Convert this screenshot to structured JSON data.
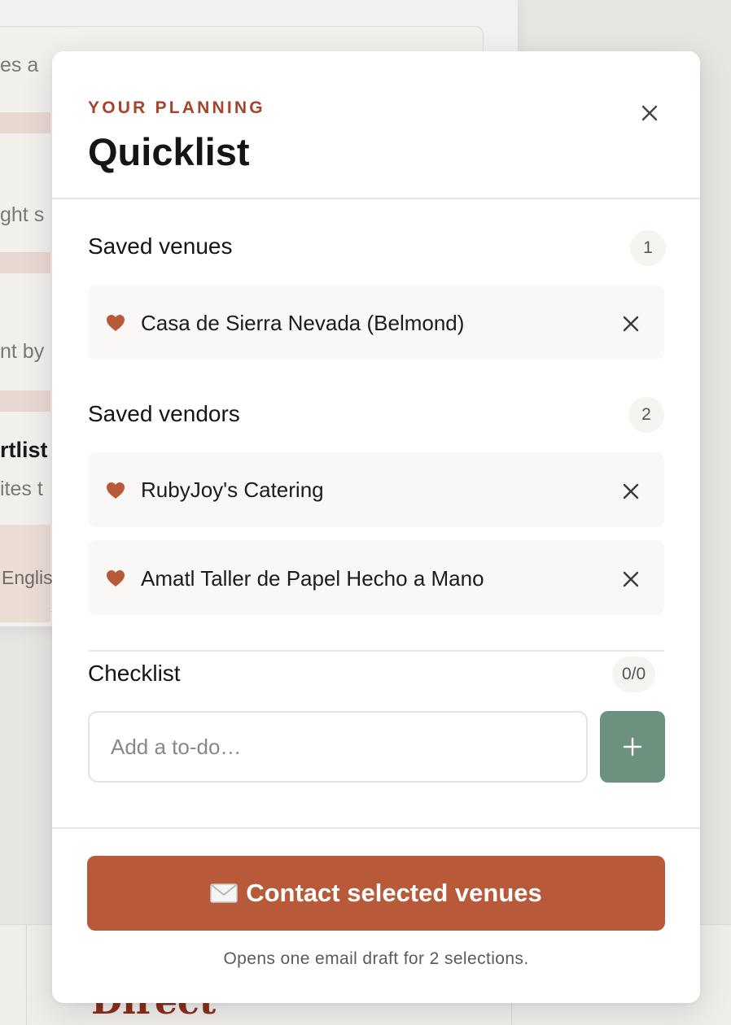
{
  "background": {
    "text_fragments": [
      "es a",
      "ght s",
      "nt by",
      "rtlist",
      "ites t",
      "Englis"
    ],
    "bottom_heading": "Direct"
  },
  "modal": {
    "eyebrow": "YOUR PLANNING",
    "title": "Quicklist",
    "close_icon": "close-icon",
    "venues": {
      "title": "Saved venues",
      "count": "1",
      "items": [
        {
          "label": "Casa de Sierra Nevada (Belmond)"
        }
      ]
    },
    "vendors": {
      "title": "Saved vendors",
      "count": "2",
      "items": [
        {
          "label": "RubyJoy's Catering"
        },
        {
          "label": "Amatl Taller de Papel Hecho a Mano"
        }
      ]
    },
    "checklist": {
      "title": "Checklist",
      "count": "0/0",
      "input_placeholder": "Add a to-do…",
      "input_value": "",
      "add_icon": "plus-icon"
    },
    "contact_button": {
      "icon": "envelope-icon",
      "label": "Contact selected venues"
    },
    "footnote": "Opens one email draft for 2 selections."
  },
  "colors": {
    "accent": "#a8432b",
    "primary_button": "#b85a39",
    "add_button": "#6c917c",
    "heart": "#b85a39"
  }
}
